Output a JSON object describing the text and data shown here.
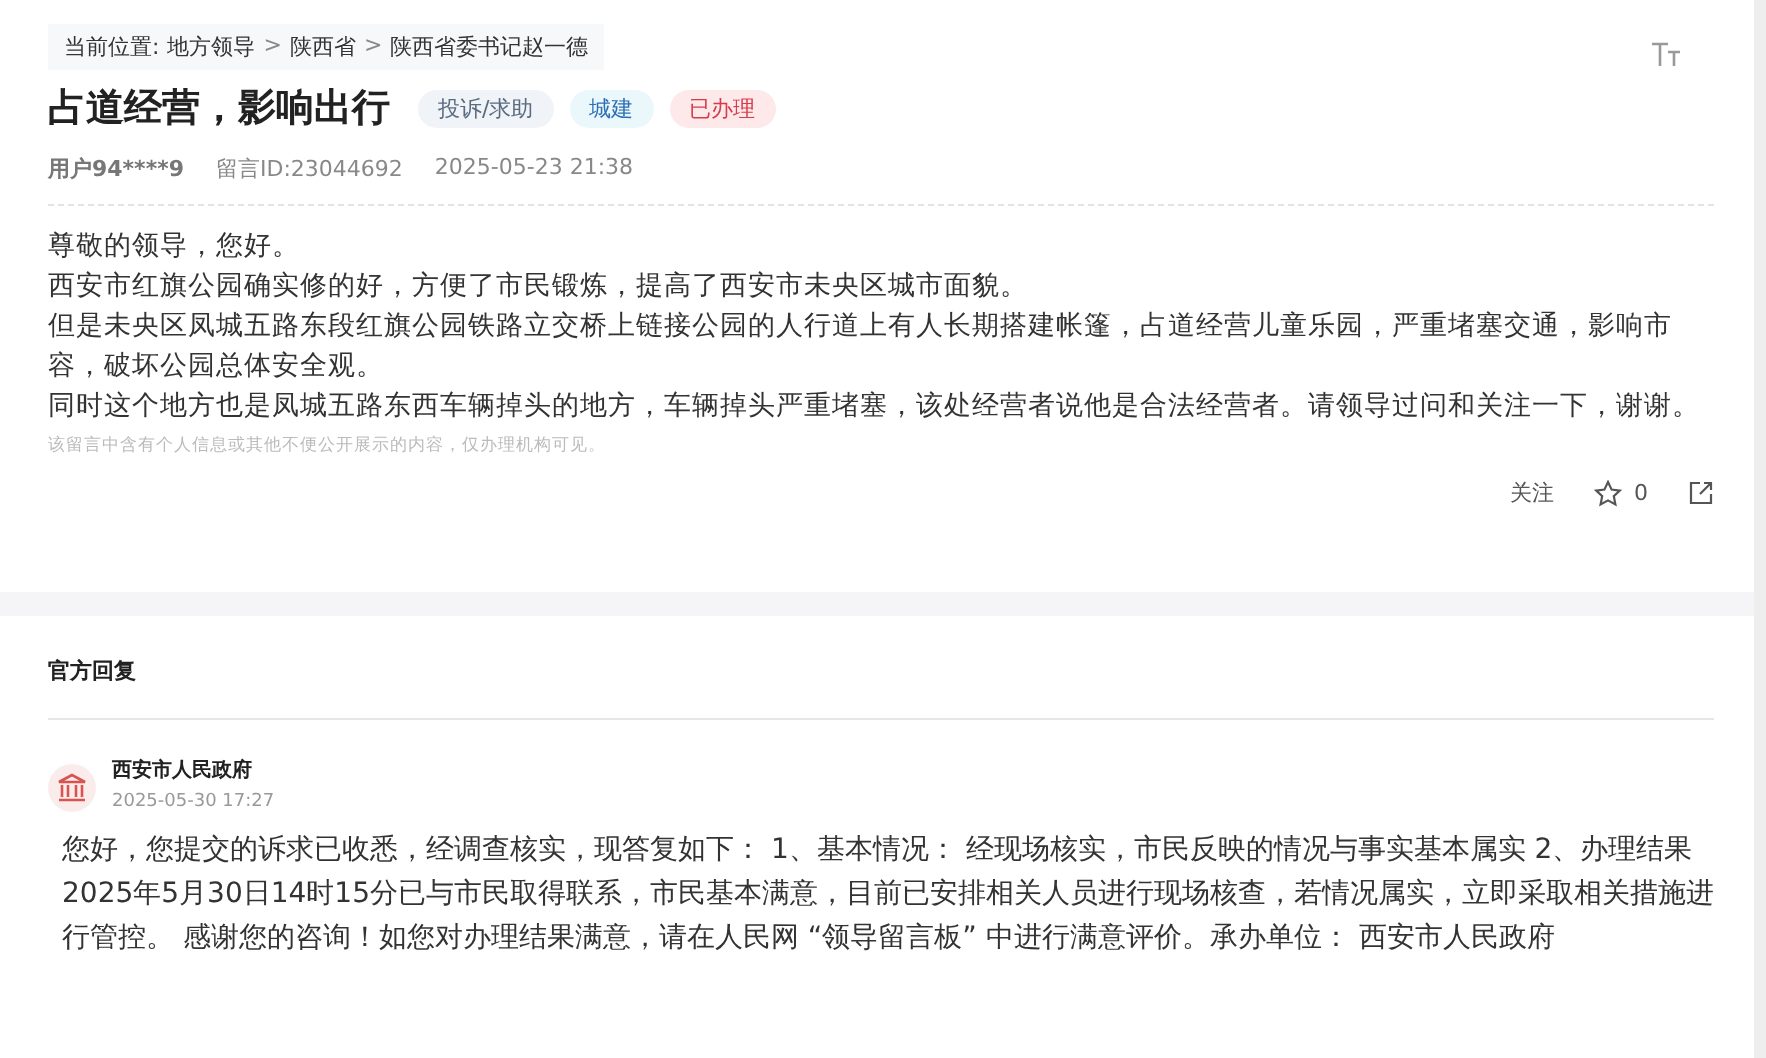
{
  "breadcrumb": {
    "label": "当前位置:",
    "items": [
      "地方领导",
      "陕西省",
      "陕西省委书记赵一德"
    ],
    "separator": ">"
  },
  "message": {
    "title": "占道经营，影响出行",
    "tags": [
      {
        "text": "投诉/求助",
        "kind": "type"
      },
      {
        "text": "城建",
        "kind": "field"
      },
      {
        "text": "已办理",
        "kind": "status"
      }
    ],
    "user": "用户94****9",
    "message_id": "留言ID:23044692",
    "time": "2025-05-23 21:38",
    "paragraphs": [
      "尊敬的领导，您好。",
      "西安市红旗公园确实修的好，方便了市民锻炼，提高了西安市未央区城市面貌。",
      "但是未央区凤城五路东段红旗公园铁路立交桥上链接公园的人行道上有人长期搭建帐篷，占道经营儿童乐园，严重堵塞交通，影响市容，破坏公园总体安全观。",
      "同时这个地方也是凤城五路东西车辆掉头的地方，车辆掉头严重堵塞，该处经营者说他是合法经营者。请领导过问和关注一下，谢谢。"
    ],
    "privacy_note": "该留言中含有个人信息或其他不便公开展示的内容，仅办理机构可见。",
    "follow": "关注",
    "likes": "0"
  },
  "reply": {
    "heading": "官方回复",
    "org": "西安市人民政府",
    "time": "2025-05-30 17:27",
    "text": " 您好，您提交的诉求已收悉，经调查核实，现答复如下： 1、基本情况： 经现场核实，市民反映的情况与事实基本属实 2、办理结果 2025年5月30日14时15分已与市民取得联系，市民基本满意，目前已安排相关人员进行现场核查，若情况属实，立即采取相关措施进行管控。 感谢您的咨询！如您对办理结果满意，请在人民网 “领导留言板” 中进行满意评价。承办单位： 西安市人民政府"
  }
}
